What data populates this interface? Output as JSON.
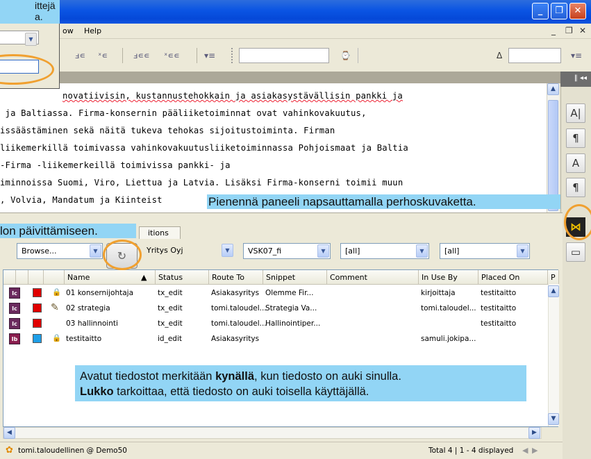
{
  "menu": {
    "items": [
      "ow",
      "Help"
    ]
  },
  "editor": {
    "lines": [
      "novatiivisin, kustannustehokkain ja asiakasystävällisin pankki ja",
      " ja Baltiassa. Firma-konsernin pääliiketoiminnat ovat vahinkovakuutus,",
      "issäästäminen sekä näitä tukeva tehokas sijoitustoiminta. Firman",
      "liikemerkillä toimivassa vahinkovakuutusliiketoiminnassa Pohjoismaat ja Baltia",
      "-Firma -liikemerkeillä toimivissa pankki- ja",
      "iminnoissa Suomi, Viro, Liettua ja Latvia. Lisäksi Firma-konserni toimii muun",
      ", Volvia, Mandatum ja Kiinteist"
    ]
  },
  "panel": {
    "tab_label": "itions",
    "filters": {
      "browse": "Browse...",
      "company": "Yritys Oyj",
      "issue": "VSK07_fi",
      "all1": "[all]",
      "all2": "[all]"
    },
    "columns": [
      "Name",
      "Status",
      "Route To",
      "Snippet",
      "Comment",
      "In Use By",
      "Placed On",
      "P"
    ],
    "rows": [
      {
        "icon": "Ic",
        "color": "#e00000",
        "lock": true,
        "pencil": false,
        "name": "01 konsernijohtaja",
        "status": "tx_edit",
        "route": "Asiakasyritys",
        "snippet": "Olemme Fir...",
        "comment": "",
        "inuse": "kirjoittaja",
        "placed": "testitaitto"
      },
      {
        "icon": "Ic",
        "color": "#e00000",
        "lock": false,
        "pencil": true,
        "name": "02 strategia",
        "status": "tx_edit",
        "route": "tomi.taloudel...",
        "snippet": "Strategia Va...",
        "comment": "",
        "inuse": "tomi.taloudel...",
        "placed": "testitaitto"
      },
      {
        "icon": "Ic",
        "color": "#e00000",
        "lock": false,
        "pencil": false,
        "name": "03 hallinnointi",
        "status": "tx_edit",
        "route": "tomi.taloudel...",
        "snippet": "Hallinointiper...",
        "comment": "",
        "inuse": "",
        "placed": "testitaitto"
      },
      {
        "icon": "Ib",
        "color": "#1f9fe8",
        "lock": true,
        "pencil": false,
        "name": "testitaitto",
        "status": "id_edit",
        "route": "Asiakasyritys",
        "snippet": "",
        "comment": "",
        "inuse": "samuli.jokipa...",
        "placed": ""
      }
    ],
    "status_user": "tomi.taloudellinen @ Demo50",
    "status_total": "Total 4 | 1 - 4 displayed"
  },
  "callouts": {
    "top_left_line1": "ittejä",
    "top_left_line2": "a.",
    "panel_hint": "Pienennä paneeli napsauttamalla perhoskuvaketta.",
    "update_hint": "lon päivittämiseen.",
    "legend_part1": "Avatut tiedostot merkitään ",
    "legend_bold1": "kynällä",
    "legend_part2": ", kun tiedosto on auki sinulla.",
    "legend_bold2": "Lukko",
    "legend_part3": " tarkoittaa, että tiedosto on auki toisella käyttäjällä."
  },
  "colors": {
    "titlebar": "#0a54e3",
    "callout": "#92d5f5",
    "highlight_ring": "#f0a030"
  }
}
